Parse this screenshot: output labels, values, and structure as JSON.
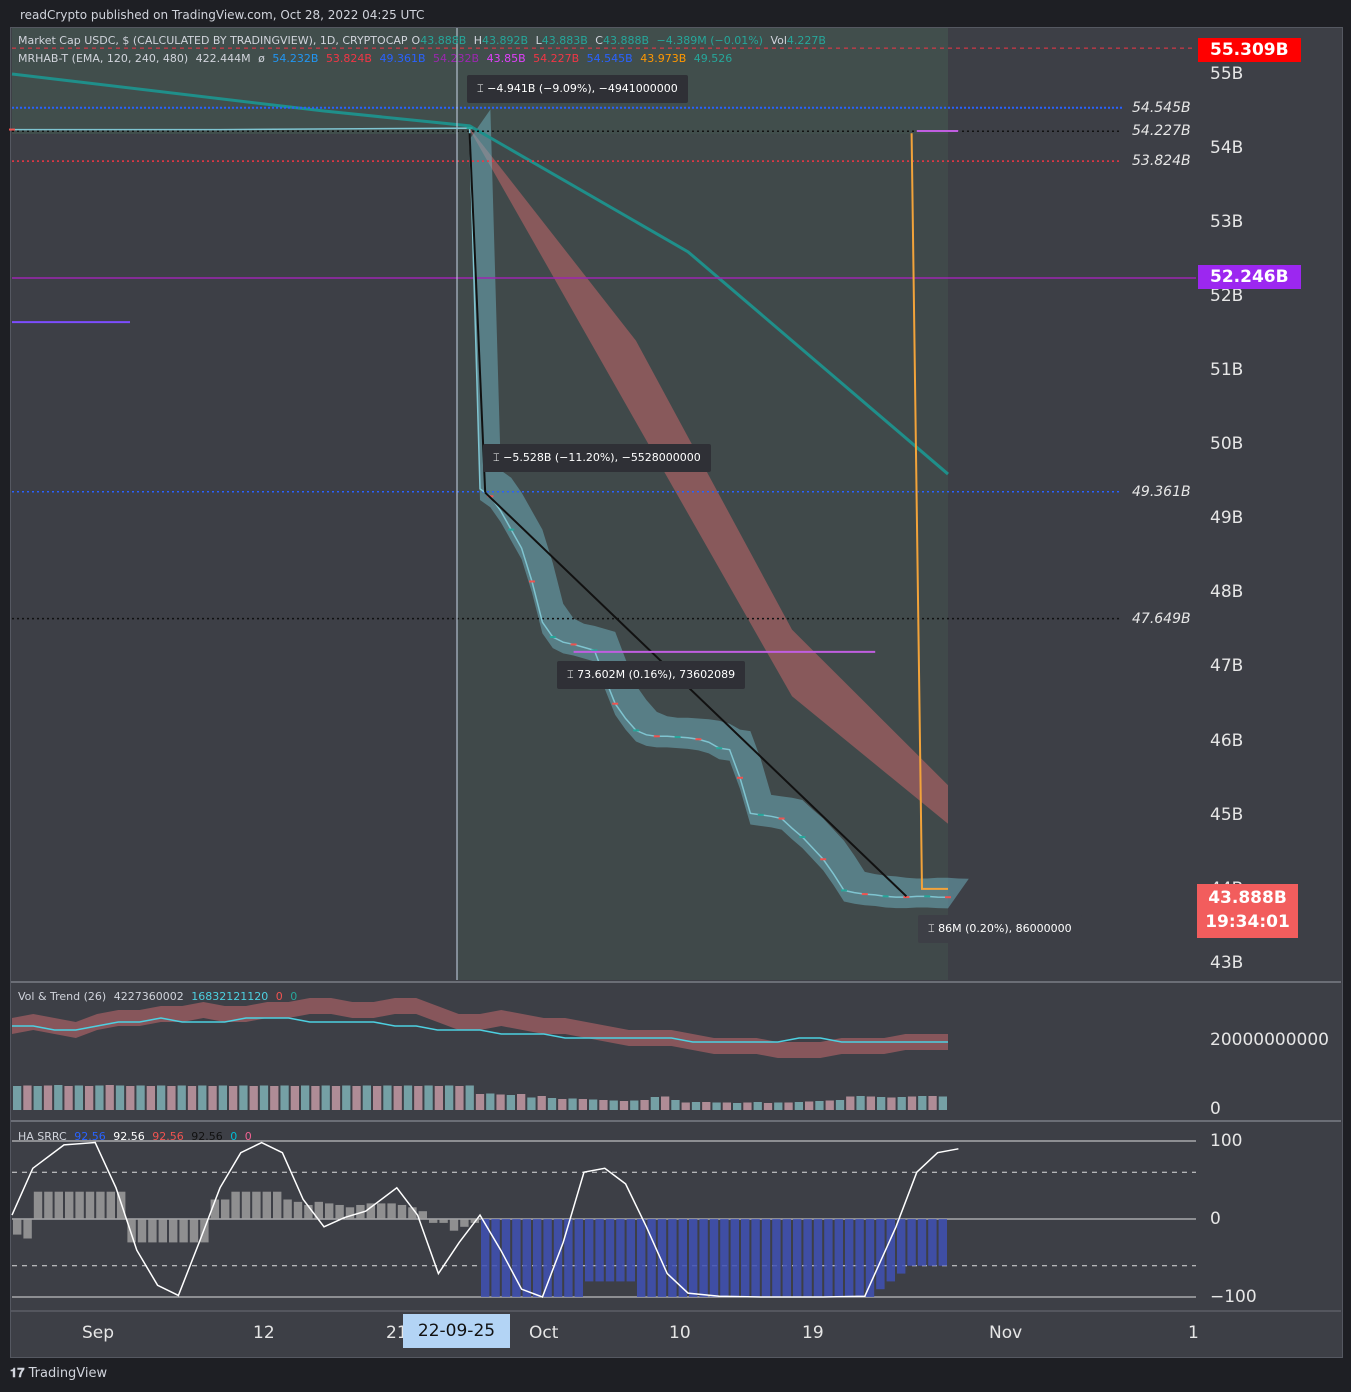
{
  "header": {
    "published": "readCrypto published on TradingView.com, Oct 28, 2022 04:25 UTC"
  },
  "main_legend": {
    "symbol": "Market Cap USDC, $ (CALCULATED BY TRADINGVIEW), 1D, CRYPTOCAP",
    "o_label": "O",
    "o_value": "43.888B",
    "h_label": "H",
    "h_value": "43.892B",
    "l_label": "L",
    "l_value": "43.883B",
    "c_label": "C",
    "c_value": "43.888B",
    "change": "−4.389M (−0.01%)",
    "vol_label": "Vol",
    "vol_value": "4.227B"
  },
  "indicator_legend": {
    "name": "MRHAB-T (EMA, 120, 240, 480)",
    "v1": "422.444M",
    "v2": "ø",
    "v3": "54.232B",
    "v4": "53.824B",
    "v5": "49.361B",
    "v6": "54.232B",
    "v7": "43.85B",
    "v8": "54.227B",
    "v9": "54.545B",
    "v10": "43.973B",
    "v11": "49.526"
  },
  "vol_legend": {
    "name": "Vol & Trend (26)",
    "v1": "4227360002",
    "v2": "16832121120",
    "v3": "0",
    "v4": "0"
  },
  "srrc_legend": {
    "name": "HA SRRC",
    "v1": "92.56",
    "v2": "92.56",
    "v3": "92.56",
    "v4": "92.56",
    "v5": "0",
    "v6": "0"
  },
  "price_axis": [
    "55B",
    "54B",
    "53B",
    "52B",
    "51B",
    "50B",
    "49B",
    "48B",
    "47B",
    "46B",
    "45B",
    "44B",
    "43B"
  ],
  "badges": {
    "top": "55.309B",
    "purple": "52.246B",
    "current_price": "43.888B",
    "countdown": "19:34:01"
  },
  "level_labels": [
    "54.545B",
    "54.227B",
    "53.824B",
    "49.361B",
    "47.649B"
  ],
  "measure_boxes": [
    "−4.941B (−9.09%), −4941000000",
    "−5.528B (−11.20%), −5528000000",
    "73.602M (0.16%), 73602089",
    "86M (0.20%), 86000000"
  ],
  "vol_axis": [
    "20000000000",
    "0"
  ],
  "srrc_axis": [
    "100",
    "0",
    "−100"
  ],
  "x_axis": [
    "Sep",
    "12",
    "21",
    "Oct",
    "10",
    "19",
    "Nov",
    "1"
  ],
  "x_highlight": "22-09-25",
  "footer": {
    "brand": "TradingView"
  },
  "colors": {
    "up": "#26a69a",
    "down": "#ef5350",
    "ema_band": "#e06d70",
    "ha_band": "#6fb3c2",
    "level_blue": "#2962ff",
    "level_red": "#f23645",
    "purple": "#9c27b0"
  },
  "chart_data": {
    "type": "line",
    "xlabel": "",
    "ylabel": "",
    "ylim": [
      42.8,
      55.6
    ],
    "series": [
      {
        "points": [
          [
            0,
            54.25
          ],
          [
            20,
            54.25
          ],
          [
            44,
            54.27
          ],
          [
            45,
            49.4
          ],
          [
            46,
            49.3
          ],
          [
            47,
            49.1
          ],
          [
            48,
            48.85
          ],
          [
            49,
            48.6
          ],
          [
            50,
            48.15
          ],
          [
            51,
            47.6
          ],
          [
            52,
            47.4
          ],
          [
            53,
            47.33
          ],
          [
            54,
            47.3
          ],
          [
            55,
            47.26
          ],
          [
            56,
            47.22
          ],
          [
            57,
            46.85
          ],
          [
            58,
            46.5
          ],
          [
            59,
            46.3
          ],
          [
            60,
            46.14
          ],
          [
            61,
            46.08
          ],
          [
            62,
            46.06
          ],
          [
            63,
            46.06
          ],
          [
            64,
            46.05
          ],
          [
            65,
            46.04
          ],
          [
            66,
            46.02
          ],
          [
            67,
            45.98
          ],
          [
            68,
            45.9
          ],
          [
            69,
            45.88
          ],
          [
            70,
            45.5
          ],
          [
            71,
            45.02
          ],
          [
            72,
            45.0
          ],
          [
            73,
            44.98
          ],
          [
            74,
            44.95
          ],
          [
            75,
            44.82
          ],
          [
            76,
            44.7
          ],
          [
            77,
            44.55
          ],
          [
            78,
            44.4
          ],
          [
            79,
            44.2
          ],
          [
            80,
            43.98
          ],
          [
            81,
            43.95
          ],
          [
            82,
            43.93
          ],
          [
            83,
            43.92
          ],
          [
            84,
            43.9
          ],
          [
            85,
            43.89
          ],
          [
            86,
            43.89
          ],
          [
            87,
            43.9
          ],
          [
            88,
            43.9
          ],
          [
            89,
            43.89
          ],
          [
            90,
            43.888
          ]
        ]
      }
    ],
    "levels": [
      54.545,
      54.227,
      53.824,
      52.246,
      49.361,
      47.649
    ],
    "ema_band_upper": [
      [
        44,
        54.27
      ],
      [
        60,
        51.4
      ],
      [
        75,
        47.5
      ],
      [
        90,
        45.4
      ]
    ],
    "ema_band_lower": [
      [
        44,
        54.25
      ],
      [
        60,
        50.3
      ],
      [
        75,
        46.6
      ],
      [
        90,
        44.88
      ]
    ],
    "slow_ema": [
      [
        0,
        55.0
      ],
      [
        30,
        54.5
      ],
      [
        44,
        54.3
      ],
      [
        65,
        52.6
      ],
      [
        90,
        49.6
      ]
    ],
    "vol_series": [
      21,
      22,
      21,
      20,
      22,
      23,
      23,
      24,
      24,
      25,
      24,
      24,
      25,
      25,
      26,
      26,
      25,
      25,
      26,
      26,
      24,
      22,
      22,
      23,
      22,
      21,
      21,
      20,
      19,
      18,
      18,
      18,
      17,
      16,
      16,
      16,
      15,
      15,
      15,
      16,
      16,
      16,
      17,
      17,
      17
    ],
    "vol_trend": [
      21,
      21,
      20,
      20,
      21,
      22,
      22,
      23,
      22,
      22,
      22,
      23,
      23,
      23,
      22,
      22,
      22,
      22,
      21,
      21,
      20,
      20,
      20,
      19,
      19,
      19,
      18,
      18,
      18,
      18,
      18,
      18,
      17,
      17,
      17,
      17,
      17,
      18,
      18,
      17,
      17,
      17,
      17,
      17,
      17
    ],
    "vol_bars": [
      4.8,
      4.9,
      4.8,
      4.9,
      5.0,
      4.8,
      4.9,
      4.8,
      4.9,
      5.0,
      4.9,
      4.8,
      4.9,
      4.8,
      4.9,
      4.8,
      4.9,
      4.8,
      4.9,
      4.8,
      4.9,
      4.8,
      4.9,
      4.8,
      4.9,
      4.8,
      4.9,
      4.8,
      4.9,
      4.8,
      4.9,
      4.8,
      4.9,
      4.8,
      4.9,
      4.8,
      4.9,
      4.8,
      4.9,
      4.8,
      4.9,
      4.8,
      4.9,
      4.8,
      4.9,
      3.2,
      3.3,
      3.1,
      3.0,
      3.2,
      2.5,
      2.8,
      2.4,
      2.2,
      2.3,
      2.2,
      2.1,
      2.0,
      1.9,
      1.8,
      1.9,
      2.0,
      2.6,
      2.7,
      2.0,
      1.5,
      1.6,
      1.6,
      1.5,
      1.5,
      1.4,
      1.5,
      1.6,
      1.4,
      1.5,
      1.5,
      1.6,
      1.7,
      1.8,
      1.9,
      2.0,
      2.7,
      2.8,
      2.7,
      2.6,
      2.5,
      2.6,
      2.7,
      2.8,
      2.8,
      2.7
    ],
    "srrc_line": [
      [
        0,
        5
      ],
      [
        2,
        65
      ],
      [
        5,
        95
      ],
      [
        8,
        98
      ],
      [
        10,
        40
      ],
      [
        12,
        -40
      ],
      [
        14,
        -85
      ],
      [
        16,
        -98
      ],
      [
        18,
        -30
      ],
      [
        20,
        40
      ],
      [
        22,
        85
      ],
      [
        24,
        98
      ],
      [
        26,
        85
      ],
      [
        28,
        25
      ],
      [
        30,
        -10
      ],
      [
        32,
        2
      ],
      [
        34,
        10
      ],
      [
        37,
        40
      ],
      [
        39,
        5
      ],
      [
        41,
        -70
      ],
      [
        43,
        -30
      ],
      [
        45,
        5
      ],
      [
        47,
        -40
      ],
      [
        49,
        -90
      ],
      [
        51,
        -100
      ],
      [
        53,
        -30
      ],
      [
        55,
        60
      ],
      [
        57,
        65
      ],
      [
        59,
        45
      ],
      [
        61,
        -10
      ],
      [
        63,
        -70
      ],
      [
        65,
        -95
      ],
      [
        68,
        -99
      ],
      [
        72,
        -100
      ],
      [
        78,
        -100
      ],
      [
        82,
        -99
      ],
      [
        85,
        -10
      ],
      [
        87,
        60
      ],
      [
        89,
        85
      ],
      [
        91,
        90
      ]
    ],
    "srrc_hist": [
      -20,
      -25,
      35,
      35,
      35,
      35,
      35,
      35,
      35,
      35,
      35,
      -30,
      -30,
      -30,
      -30,
      -30,
      -30,
      -30,
      -30,
      25,
      25,
      35,
      35,
      35,
      35,
      35,
      25,
      22,
      18,
      22,
      20,
      18,
      15,
      18,
      20,
      20,
      20,
      18,
      15,
      10,
      -5,
      -5,
      -15,
      -10,
      -5,
      -100,
      -100,
      -100,
      -100,
      -100,
      -100,
      -100,
      -100,
      -100,
      -100,
      -80,
      -80,
      -80,
      -80,
      -80,
      -100,
      -100,
      -100,
      -100,
      -100,
      -100,
      -100,
      -100,
      -100,
      -100,
      -100,
      -100,
      -100,
      -100,
      -100,
      -100,
      -100,
      -100,
      -100,
      -100,
      -100,
      -100,
      -100,
      -90,
      -80,
      -70,
      -60,
      -60,
      -60,
      -60
    ]
  }
}
